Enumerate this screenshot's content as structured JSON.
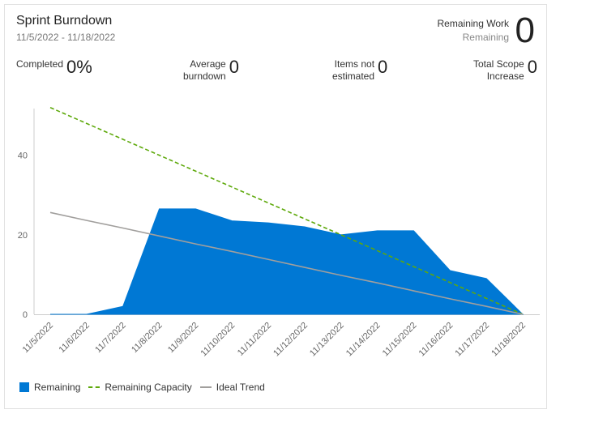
{
  "header": {
    "title": "Sprint Burndown",
    "date_range": "11/5/2022 - 11/18/2022",
    "remaining_work_label": "Remaining Work",
    "remaining_work_sub": "Remaining",
    "remaining_work_value": "0"
  },
  "stats": {
    "completed": {
      "label": "Completed",
      "value": "0%"
    },
    "average_burndown": {
      "label_line1": "Average",
      "label_line2": "burndown",
      "value": "0"
    },
    "items_not_estimated": {
      "label_line1": "Items not",
      "label_line2": "estimated",
      "value": "0"
    },
    "total_scope_increase": {
      "label_line1": "Total Scope",
      "label_line2": "Increase",
      "value": "0"
    }
  },
  "colors": {
    "remaining": "#0078d4",
    "remaining_capacity": "#5ea90b",
    "ideal_trend": "#a19f9d",
    "axis": "#cccccc"
  },
  "chart_data": {
    "type": "area",
    "x": [
      "11/5/2022",
      "11/6/2022",
      "11/7/2022",
      "11/8/2022",
      "11/9/2022",
      "11/10/2022",
      "11/11/2022",
      "11/12/2022",
      "11/13/2022",
      "11/14/2022",
      "11/15/2022",
      "11/16/2022",
      "11/17/2022",
      "11/18/2022"
    ],
    "ylim": [
      0,
      55
    ],
    "yticks": [
      0,
      20,
      40
    ],
    "grid": false,
    "legend_position": "bottom-left",
    "series": [
      {
        "name": "Remaining",
        "style": "area",
        "values": [
          0,
          0,
          2,
          26.5,
          26.5,
          23.5,
          23,
          22,
          20,
          21,
          21,
          11,
          9,
          0
        ]
      },
      {
        "name": "Remaining Capacity",
        "style": "dashed",
        "values": [
          52,
          48,
          44,
          40,
          36,
          32,
          28,
          24,
          20,
          16,
          12,
          8,
          4,
          0
        ]
      },
      {
        "name": "Ideal Trend",
        "style": "line",
        "values": [
          25.6,
          23.6,
          21.7,
          19.7,
          17.7,
          15.8,
          13.8,
          11.8,
          9.8,
          7.9,
          5.9,
          3.9,
          2.0,
          0
        ]
      }
    ]
  }
}
